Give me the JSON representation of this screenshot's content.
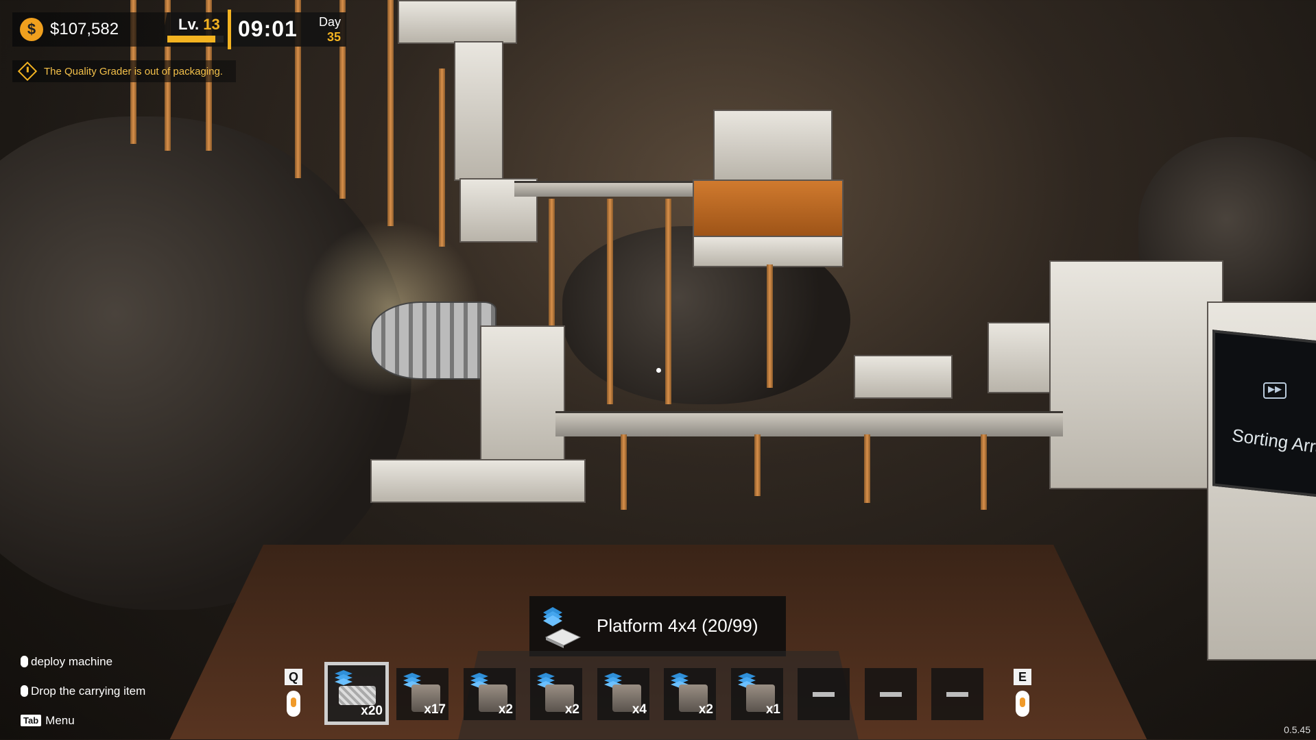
{
  "hud": {
    "money": "$107,582",
    "coin_symbol": "$",
    "level_label": "Lv.",
    "level_value": "13",
    "xp_progress": 0.85,
    "time": "09:01",
    "day_label": "Day",
    "day_value": "35",
    "notification": "The Quality Grader is out of packaging."
  },
  "controls": [
    {
      "icon": "mouse-left-icon",
      "label": "deploy machine"
    },
    {
      "icon": "mouse-right-icon",
      "label": "Drop the carrying item"
    },
    {
      "key": "Tab",
      "label": "Menu"
    }
  ],
  "selected_item": {
    "label": "Platform 4x4 (20/99)"
  },
  "hotbar": {
    "prev_key": "Q",
    "next_key": "E",
    "slots": [
      {
        "count": "x20",
        "selected": true
      },
      {
        "count": "x17"
      },
      {
        "count": "x2"
      },
      {
        "count": "x2"
      },
      {
        "count": "x4"
      },
      {
        "count": "x2"
      },
      {
        "count": "x1"
      },
      {
        "count": ""
      },
      {
        "count": ""
      },
      {
        "count": ""
      }
    ]
  },
  "world": {
    "sorting_array_label": "Sorting Array"
  },
  "version": "0.5.45",
  "colors": {
    "accent": "#f3b321",
    "coin": "#f0a01e",
    "notice": "#f3c04a"
  }
}
